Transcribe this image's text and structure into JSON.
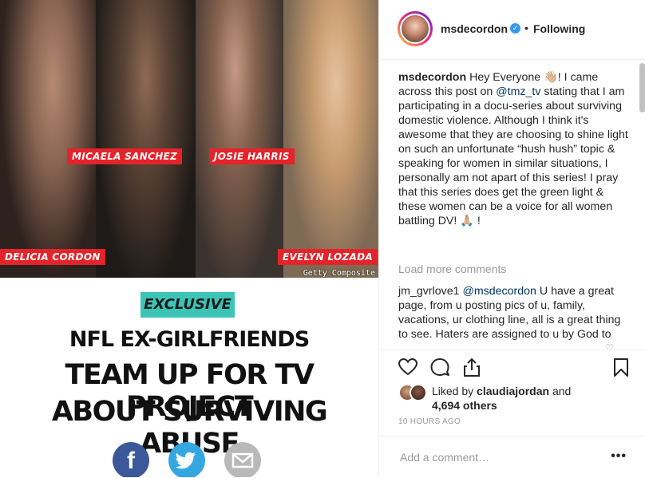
{
  "post_image": {
    "names": [
      "MICAELA SANCHEZ",
      "JOSIE HARRIS",
      "DELICIA CORDON",
      "EVELYN LOZADA"
    ],
    "credit": "Getty Composite",
    "badge": "EXCLUSIVE",
    "subhead": "NFL EX-GIRLFRIENDS",
    "headline_line1": "TEAM UP FOR TV PROJECT",
    "headline_line2": "ABOUT SURVIVING ABUSE",
    "share_icons": [
      "facebook-icon",
      "twitter-icon",
      "email-icon"
    ],
    "fb_glyph": "f",
    "tw_glyph": "🐦",
    "em_glyph": "✉"
  },
  "header": {
    "username": "msdecordon",
    "verified_glyph": "✓",
    "dot": "•",
    "follow_status": "Following"
  },
  "caption": {
    "username": "msdecordon",
    "text_before": " Hey Everyone 👋🏼󠀠! I came across this post on ",
    "mention": "@tmz_tv",
    "text_after": " stating that I am participating in a docu-series about surviving domestic violence. Although I think it's awesome that they are choosing to shine light on such an unfortunate “hush hush” topic & speaking for women in similar situations, I personally am not apart of this series! I pray that this series does get the green light & these women can be a voice for all women battling DV! 🙏🏼󠀠 !"
  },
  "load_more": "Load more comments",
  "comment": {
    "username": "jm_gvrlove1",
    "mention": "@msdecordon",
    "text": " U have a great page, from u posting pics of u, family, vacations, ur clothing line, all is a great thing to see. Haters are assigned to u by God to"
  },
  "likes": {
    "prefix": "Liked by ",
    "user": "claudiajordan",
    "middle": " and",
    "count": "4,694 others"
  },
  "timestamp": "10 HOURS AGO",
  "add_comment_placeholder": "Add a comment…",
  "more_glyph": "•••",
  "colors": {
    "accent_red": "#e5232a",
    "badge_teal": "#3cc4b6",
    "facebook": "#3b5998",
    "twitter": "#35a7e0",
    "verified": "#3897f0",
    "mention": "#003569"
  }
}
